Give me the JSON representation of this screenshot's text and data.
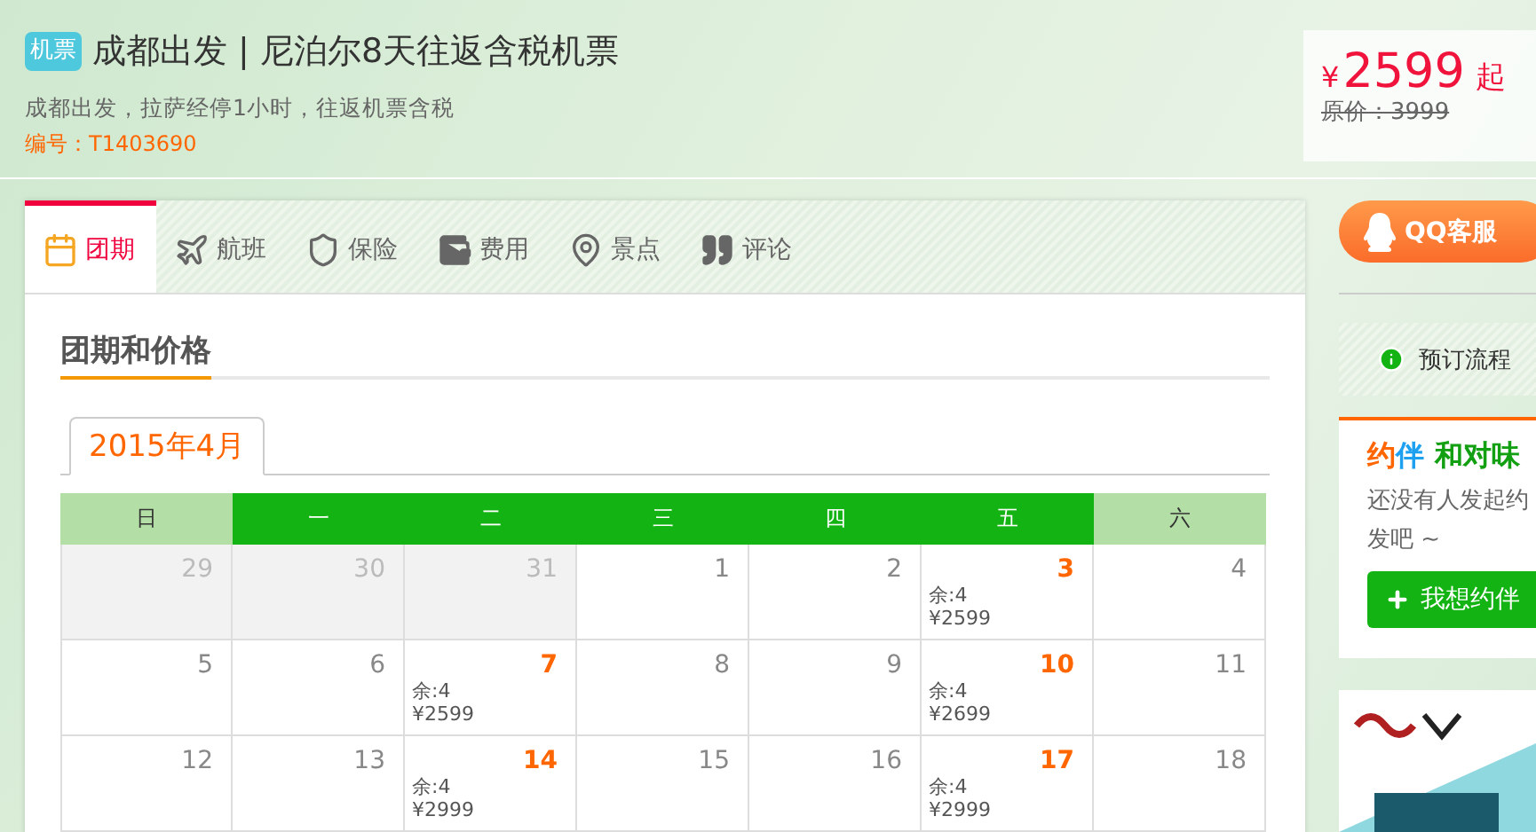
{
  "header": {
    "badge": "机票",
    "title": "成都出发 | 尼泊尔8天往返含税机票",
    "subtitle": "成都出发，拉萨经停1小时，往返机票含税",
    "code": "编号：T1403690"
  },
  "price": {
    "currency": "¥",
    "amount": "2599",
    "suffix": "起",
    "original": "原价：3999"
  },
  "tabs": [
    {
      "label": "团期",
      "selected": true
    },
    {
      "label": "航班",
      "selected": false
    },
    {
      "label": "保险",
      "selected": false
    },
    {
      "label": "费用",
      "selected": false
    },
    {
      "label": "景点",
      "selected": false
    },
    {
      "label": "评论",
      "selected": false
    }
  ],
  "section_title": "团期和价格",
  "month_tabs": [
    {
      "label": "2015年4月",
      "selected": true
    }
  ],
  "calendar": {
    "weekdays": [
      {
        "label": "日",
        "weekend": true
      },
      {
        "label": "一",
        "weekend": false
      },
      {
        "label": "二",
        "weekend": false
      },
      {
        "label": "三",
        "weekend": false
      },
      {
        "label": "四",
        "weekend": false
      },
      {
        "label": "五",
        "weekend": false
      },
      {
        "label": "六",
        "weekend": true
      }
    ],
    "weeks": [
      [
        {
          "day": "29",
          "kind": "past"
        },
        {
          "day": "30",
          "kind": "past"
        },
        {
          "day": "31",
          "kind": "past"
        },
        {
          "day": "1",
          "kind": "normal"
        },
        {
          "day": "2",
          "kind": "normal"
        },
        {
          "day": "3",
          "kind": "tour",
          "seats": "余:4",
          "price": "¥2599"
        },
        {
          "day": "4",
          "kind": "normal"
        }
      ],
      [
        {
          "day": "5",
          "kind": "normal"
        },
        {
          "day": "6",
          "kind": "normal"
        },
        {
          "day": "7",
          "kind": "tour",
          "seats": "余:4",
          "price": "¥2599"
        },
        {
          "day": "8",
          "kind": "normal"
        },
        {
          "day": "9",
          "kind": "normal"
        },
        {
          "day": "10",
          "kind": "tour",
          "seats": "余:4",
          "price": "¥2699"
        },
        {
          "day": "11",
          "kind": "normal"
        }
      ],
      [
        {
          "day": "12",
          "kind": "normal"
        },
        {
          "day": "13",
          "kind": "normal"
        },
        {
          "day": "14",
          "kind": "tour",
          "seats": "余:4",
          "price": "¥2999"
        },
        {
          "day": "15",
          "kind": "normal"
        },
        {
          "day": "16",
          "kind": "normal"
        },
        {
          "day": "17",
          "kind": "tour",
          "seats": "余:4",
          "price": "¥2999"
        },
        {
          "day": "18",
          "kind": "normal"
        }
      ]
    ]
  },
  "sidebar": {
    "qq_button": "QQ客服",
    "booking_flow": "预订流程",
    "companion": {
      "title_a": "约",
      "title_b": "伴",
      "title_rest": "和对味",
      "text_line1": "还没有人发起约",
      "text_line2": "发吧 ~",
      "button": "我想约伴"
    }
  }
}
